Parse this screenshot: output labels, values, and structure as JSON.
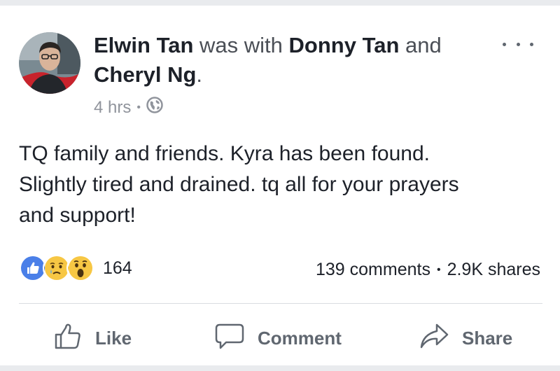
{
  "post": {
    "author": "Elwin Tan",
    "with_text": "was with",
    "tagged_1": "Donny Tan",
    "and_text": "and",
    "tagged_2": "Cheryl Ng",
    "period": ".",
    "timestamp": "4 hrs",
    "meta_separator": "•",
    "audience_icon": "globe-icon",
    "text_line_1": "TQ family and friends. Kyra has been found.",
    "text_line_2": "Slightly tired and drained. tq all for your prayers",
    "text_line_3": "and support!"
  },
  "reactions": {
    "icons": [
      "like-reaction-icon",
      "sad-reaction-icon",
      "wow-reaction-icon"
    ],
    "count": "164"
  },
  "stats": {
    "comments": "139 comments",
    "separator": "•",
    "shares": "2.9K shares"
  },
  "actions": {
    "like_label": "Like",
    "comment_label": "Comment",
    "share_label": "Share"
  },
  "colors": {
    "like_blue": "#4a7fe8",
    "emoji_yellow": "#f7c744",
    "text_primary": "#1d2129",
    "text_muted": "#90949c",
    "action_gray": "#606770"
  }
}
